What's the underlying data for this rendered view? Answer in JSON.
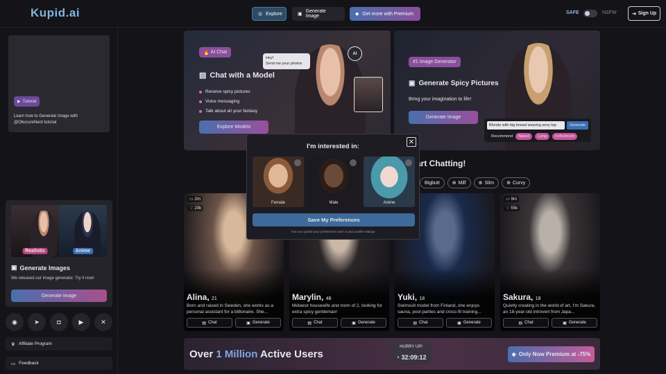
{
  "app": {
    "logo": "Kupid.ai"
  },
  "nav": {
    "explore": "Explore",
    "generate_image": "Generate Image",
    "premium": "Get more with Premium",
    "safe": "SAFE",
    "nsfw": "NSFW",
    "sign_up": "Sign Up"
  },
  "sidebar": {
    "tutorial_badge": "Tutorial",
    "tutorial_text": "Learn how to Generate Image with @ObscureNerd tutorial",
    "gen_card": {
      "label_realistic": "Realistic",
      "label_anime": "Anime",
      "title": "Generate Images",
      "desc": "We released our image generator. Try it now!",
      "button": "Generate Image"
    },
    "socials": [
      "discord-icon",
      "telegram-icon",
      "instagram-icon",
      "youtube-icon",
      "x-icon"
    ],
    "affiliate": "Affiliate Program",
    "feedback": "Feedback"
  },
  "hero_chat": {
    "badge": "AI Chat",
    "title": "Chat with a Model",
    "bullets": [
      "Receive spicy pictures",
      "Voice messaging",
      "Talk about all your fantasy"
    ],
    "button": "Explore Models",
    "bubble": "Hey!\nSend me your photos",
    "ai_badge": "AI"
  },
  "hero_gen": {
    "badge": "#1 Image Generator",
    "title": "Generate Spicy Pictures",
    "subtitle": "Bring your imagination to life!",
    "button": "Generate Image",
    "prompt_text": "Blonde with big breast wearing sexy top",
    "prompt_button": "Generate",
    "recommend_label": "Recommend",
    "chips": [
      "Naked",
      "Lying",
      "In Bedroom"
    ]
  },
  "section": {
    "title": "art Chatting!",
    "filters": [
      "Bigbutt",
      "Milf",
      "Slim",
      "Curvy"
    ]
  },
  "cards": [
    {
      "name": "Alina",
      "age": "21",
      "stat1": "2m",
      "stat2": "20k",
      "desc": "Born and raised in Sweden, she works as a personal assistant for a billionaire. She...",
      "chat": "Chat",
      "generate": "Generate",
      "palette": [
        "#d8b89a",
        "#6a5248"
      ]
    },
    {
      "name": "Marylin",
      "age": "48",
      "stat1": "",
      "stat2": "",
      "desc": "Midwest housewife and mom of 2, looking for extra spicy gentleman!",
      "chat": "Chat",
      "generate": "Generate",
      "palette": [
        "#c9b8a8",
        "#2a2628"
      ]
    },
    {
      "name": "Yuki",
      "age": "18",
      "stat1": "",
      "stat2": "",
      "desc": "Swimsuit model from Finland, she enjoys sauna, pool parties and cross-fit training...",
      "chat": "Chat",
      "generate": "Generate",
      "palette": [
        "#5a6a8a",
        "#1a2a4a"
      ]
    },
    {
      "name": "Sakura",
      "age": "18",
      "stat1": "9m",
      "stat2": "55k",
      "desc": "Quietly creating in the world of art, I'm Sakura, an 18-year-old introvert from Japa...",
      "chat": "Chat",
      "generate": "Generate",
      "palette": [
        "#b8b0a8",
        "#3a3436"
      ]
    }
  ],
  "bottom": {
    "title_pre": "Over ",
    "title_hl": "1 Million",
    "title_post": " Active Users",
    "hurry": "HURRY UP!",
    "countdown": "32:09:12",
    "premium": "Only Now Premium at -75%"
  },
  "modal": {
    "title": "I'm interested in:",
    "options": [
      "Female",
      "Male",
      "Anime"
    ],
    "save": "Save My Preferences",
    "note": "You can update your preferences later in your profile settings"
  }
}
